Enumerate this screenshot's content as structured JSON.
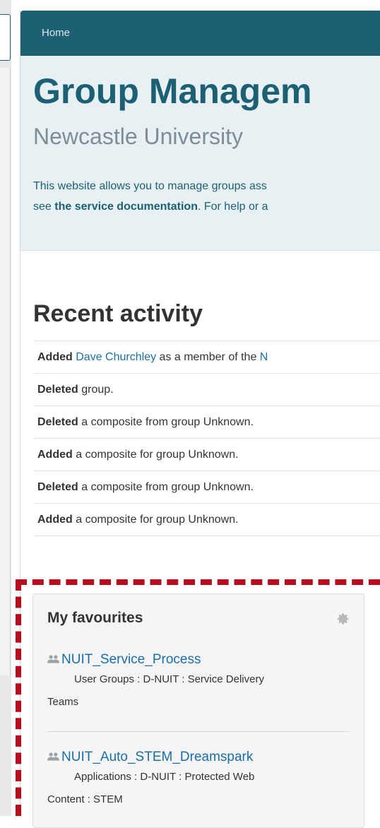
{
  "breadcrumb": {
    "home": "Home"
  },
  "hero": {
    "title": "Group Managem",
    "subtitle": "Newcastle University",
    "line1": "This website allows you to manage groups ass",
    "line2_prefix": "see ",
    "line2_link": "the service documentation",
    "line2_suffix": ". For help or a"
  },
  "activity": {
    "title": "Recent activity",
    "items": [
      {
        "verb": "Added",
        "link": "Dave Churchley",
        "rest": " as a member of the ",
        "tail_link": "N"
      },
      {
        "verb": "Deleted",
        "rest": " group."
      },
      {
        "verb": "Deleted",
        "rest": " a composite from group Unknown."
      },
      {
        "verb": "Added",
        "rest": " a composite for group Unknown."
      },
      {
        "verb": "Deleted",
        "rest": " a composite from group Unknown."
      },
      {
        "verb": "Added",
        "rest": " a composite for group Unknown."
      }
    ]
  },
  "favourites": {
    "title": "My favourites",
    "settings_icon": "gear-icon",
    "items": [
      {
        "name": "NUIT_Service_Process",
        "path_line1": "User Groups : D-NUIT : Service Delivery",
        "path_line2": "Teams"
      },
      {
        "name": "NUIT_Auto_STEM_Dreamspark",
        "path_line1": "Applications : D-NUIT : Protected Web",
        "path_line2": "Content : STEM"
      }
    ]
  },
  "colors": {
    "brand": "#1e6073",
    "hero_bg": "#e7f0f3",
    "link": "#1a6ea8",
    "highlight_dash": "#b50e1e"
  }
}
